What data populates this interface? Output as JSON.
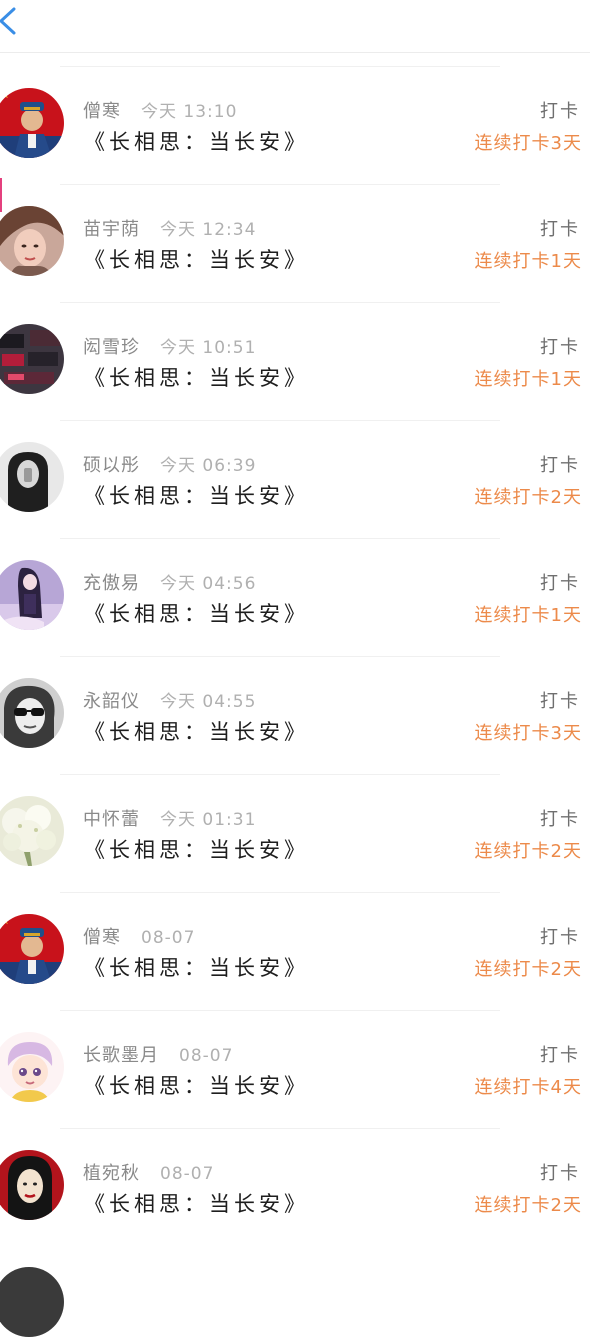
{
  "nav": {
    "back_icon": "chevron-left-icon",
    "accent_color": "#3a8ee6"
  },
  "colors": {
    "streak": "#ec8a4a",
    "meta": "#8a8a8a",
    "title": "#1e1e1e"
  },
  "records": [
    {
      "user": "僧寒",
      "time": "今天 13:10",
      "title": "《长相思：当长安》",
      "action": "打卡",
      "streak": "连续打卡3天",
      "avatar": "soldier-avatar"
    },
    {
      "user": "苗宇荫",
      "time": "今天 12:34",
      "title": "《长相思：当长安》",
      "action": "打卡",
      "streak": "连续打卡1天",
      "avatar": "woman-portrait-avatar"
    },
    {
      "user": "闳雪珍",
      "time": "今天 10:51",
      "title": "《长相思：当长安》",
      "action": "打卡",
      "streak": "连续打卡1天",
      "avatar": "banner-photo-avatar"
    },
    {
      "user": "硕以彤",
      "time": "今天 06:39",
      "title": "《长相思：当长安》",
      "action": "打卡",
      "streak": "连续打卡2天",
      "avatar": "mirror-selfie-avatar"
    },
    {
      "user": "充傲易",
      "time": "今天 04:56",
      "title": "《长相思：当长安》",
      "action": "打卡",
      "streak": "连续打卡1天",
      "avatar": "anime-girl-avatar"
    },
    {
      "user": "永韶仪",
      "time": "今天 04:55",
      "title": "《长相思：当长安》",
      "action": "打卡",
      "streak": "连续打卡3天",
      "avatar": "sunglasses-avatar"
    },
    {
      "user": "中怀蕾",
      "time": "今天 01:31",
      "title": "《长相思：当长安》",
      "action": "打卡",
      "streak": "连续打卡2天",
      "avatar": "flowers-avatar"
    },
    {
      "user": "僧寒",
      "time": "08-07",
      "title": "《长相思：当长安》",
      "action": "打卡",
      "streak": "连续打卡2天",
      "avatar": "soldier-avatar"
    },
    {
      "user": "长歌墨月",
      "time": "08-07",
      "title": "《长相思：当长安》",
      "action": "打卡",
      "streak": "连续打卡4天",
      "avatar": "cartoon-boy-avatar"
    },
    {
      "user": "植宛秋",
      "time": "08-07",
      "title": "《长相思：当长安》",
      "action": "打卡",
      "streak": "连续打卡2天",
      "avatar": "illustrated-woman-avatar"
    }
  ]
}
